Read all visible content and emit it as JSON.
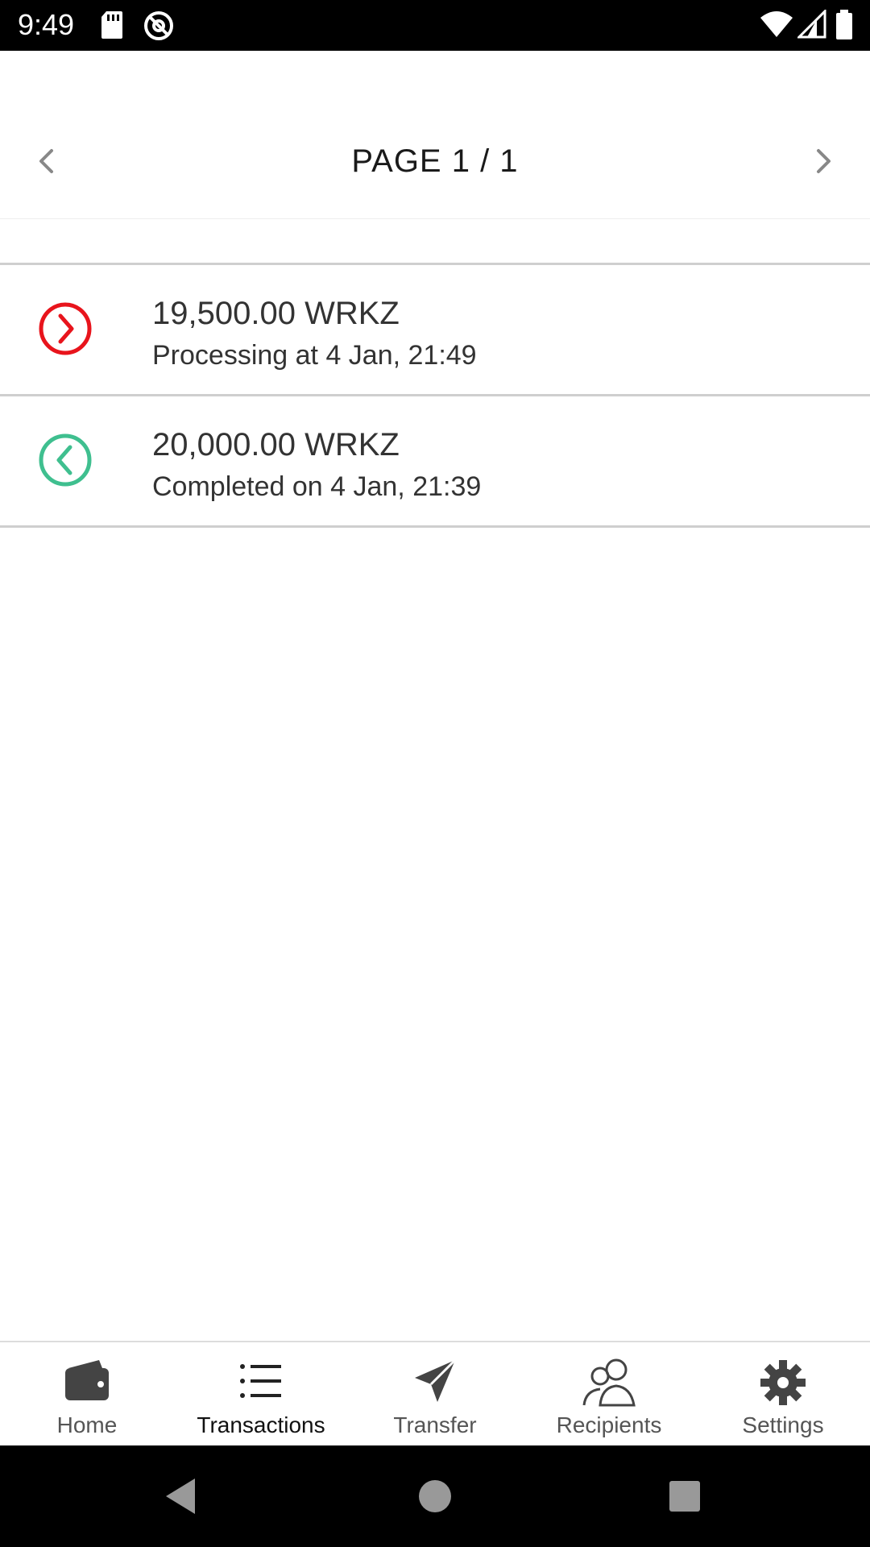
{
  "status_bar": {
    "time": "9:49",
    "icons": [
      "sd-card-icon",
      "at-sign-icon",
      "wifi-icon",
      "signal-icon",
      "battery-icon"
    ]
  },
  "pager": {
    "title": "PAGE 1 / 1",
    "prev_icon": "chevron-left-icon",
    "next_icon": "chevron-right-icon"
  },
  "transactions": [
    {
      "amount": "19,500.00 WRKZ",
      "status": "Processing at 4 Jan, 21:49",
      "direction": "outgoing",
      "icon": "circle-chevron-right-icon",
      "color": "#e8141c"
    },
    {
      "amount": "20,000.00 WRKZ",
      "status": "Completed on 4 Jan, 21:39",
      "direction": "incoming",
      "icon": "circle-chevron-left-icon",
      "color": "#3fbf8f"
    }
  ],
  "bottom_nav": {
    "active": "Transactions",
    "items": [
      {
        "label": "Home",
        "icon": "wallet-icon"
      },
      {
        "label": "Transactions",
        "icon": "list-icon"
      },
      {
        "label": "Transfer",
        "icon": "paper-plane-icon"
      },
      {
        "label": "Recipients",
        "icon": "users-icon"
      },
      {
        "label": "Settings",
        "icon": "gear-icon"
      }
    ]
  },
  "system_nav": {
    "icons": [
      "back-icon",
      "home-circle-icon",
      "recents-square-icon"
    ]
  }
}
